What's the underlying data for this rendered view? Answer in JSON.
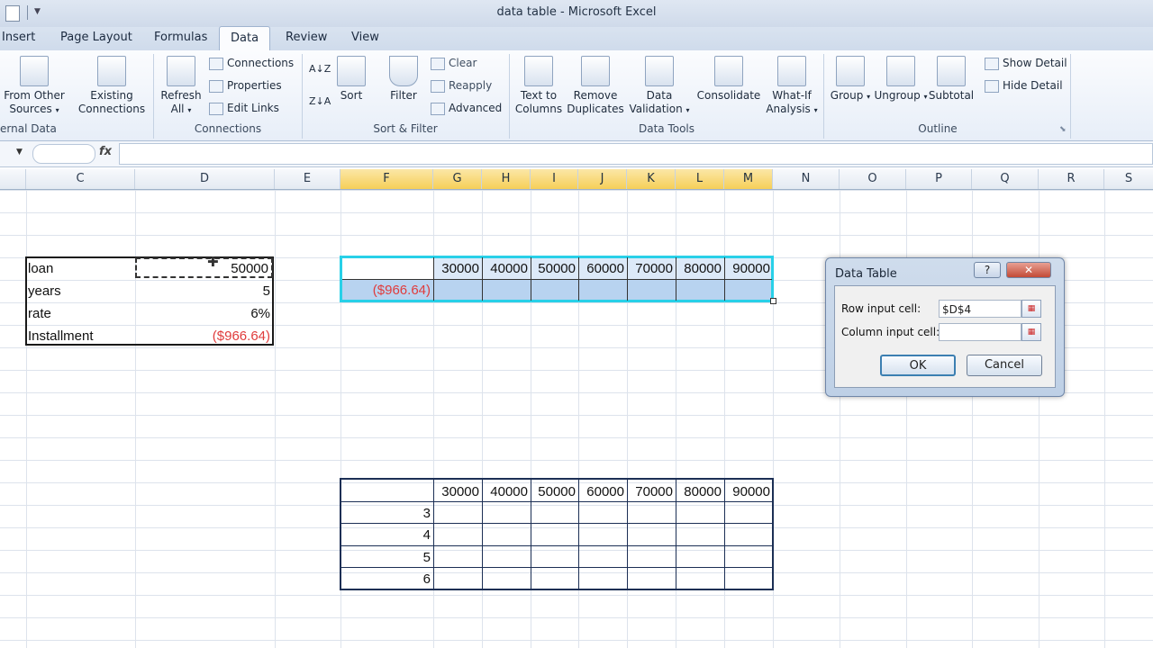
{
  "window": {
    "title": "data table - Microsoft Excel"
  },
  "tabs": [
    "Insert",
    "Page Layout",
    "Formulas",
    "Data",
    "Review",
    "View"
  ],
  "active_tab": "Data",
  "ribbon": {
    "get_external_data": {
      "group_label": "ernal Data",
      "from_other_sources": [
        "From Other",
        "Sources"
      ],
      "existing_connections": [
        "Existing",
        "Connections"
      ]
    },
    "connections": {
      "group_label": "Connections",
      "refresh_all": [
        "Refresh",
        "All"
      ],
      "connections": "Connections",
      "properties": "Properties",
      "edit_links": "Edit Links"
    },
    "sort_filter": {
      "group_label": "Sort & Filter",
      "sort_az": "A↓Z",
      "sort_za": "Z↓A",
      "sort": "Sort",
      "filter": "Filter",
      "clear": "Clear",
      "reapply": "Reapply",
      "advanced": "Advanced"
    },
    "data_tools": {
      "group_label": "Data Tools",
      "text_to_columns": [
        "Text to",
        "Columns"
      ],
      "remove_duplicates": [
        "Remove",
        "Duplicates"
      ],
      "data_validation": [
        "Data",
        "Validation"
      ],
      "consolidate": "Consolidate",
      "what_if": [
        "What-If",
        "Analysis"
      ]
    },
    "outline": {
      "group_label": "Outline",
      "group": "Group",
      "ungroup": "Ungroup",
      "subtotal": "Subtotal",
      "show_detail": "Show Detail",
      "hide_detail": "Hide Detail"
    }
  },
  "formula_bar": {
    "fx": "fx",
    "value": ""
  },
  "columns": [
    "C",
    "D",
    "E",
    "F",
    "G",
    "H",
    "I",
    "J",
    "K",
    "L",
    "M",
    "N",
    "O",
    "P",
    "Q",
    "R",
    "S"
  ],
  "selected_columns": [
    "F",
    "G",
    "H",
    "I",
    "J",
    "K",
    "L",
    "M"
  ],
  "sheet": {
    "inputs": [
      {
        "label": "loan",
        "value": "50000"
      },
      {
        "label": "years",
        "value": "5"
      },
      {
        "label": "rate",
        "value": "6%"
      },
      {
        "label": "Installment",
        "value": "($966.64)"
      }
    ],
    "table1": {
      "header": [
        "30000",
        "40000",
        "50000",
        "60000",
        "70000",
        "80000",
        "90000"
      ],
      "formula_result": "($966.64)"
    },
    "table2": {
      "header": [
        "30000",
        "40000",
        "50000",
        "60000",
        "70000",
        "80000",
        "90000"
      ],
      "rows": [
        "3",
        "4",
        "5",
        "6"
      ]
    }
  },
  "dialog": {
    "title": "Data Table",
    "help": "?",
    "close": "✕",
    "row_input_label": "Row input cell:",
    "row_input_value": "$D$4",
    "col_input_label": "Column input cell:",
    "col_input_value": "",
    "ok": "OK",
    "cancel": "Cancel"
  }
}
